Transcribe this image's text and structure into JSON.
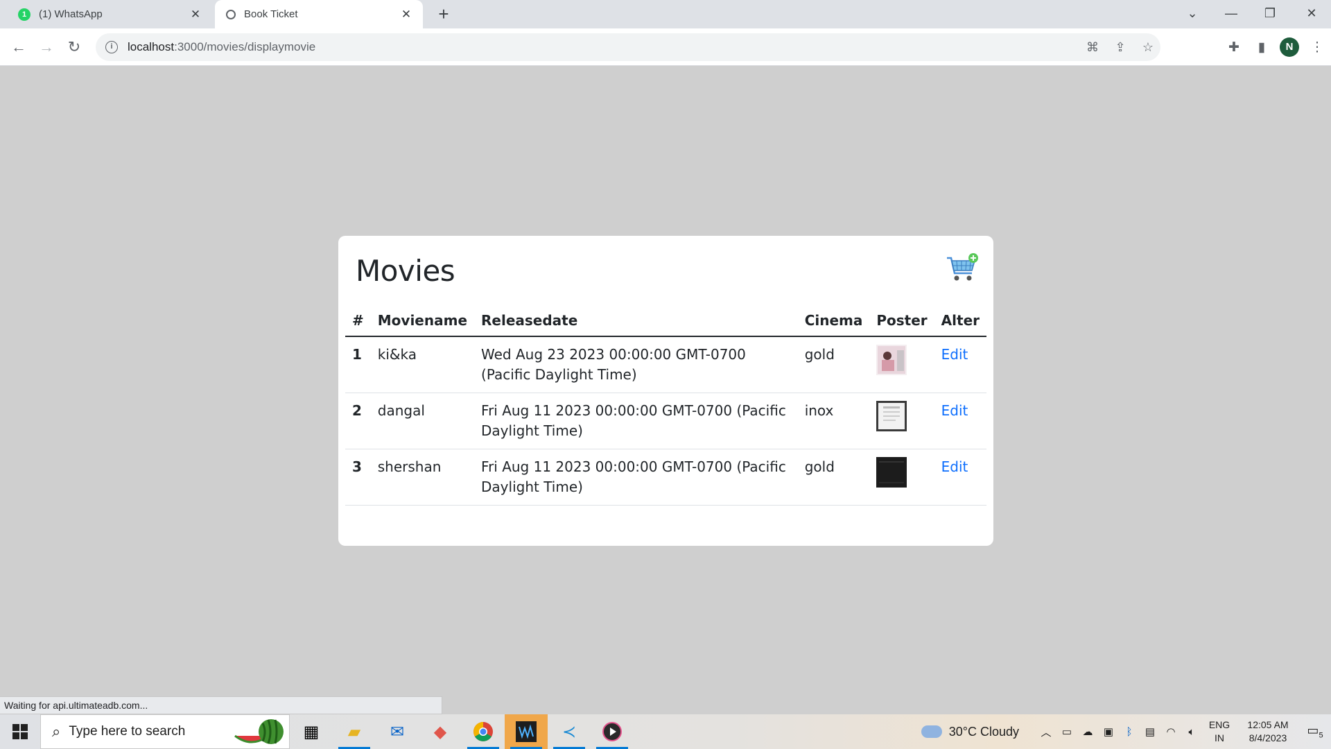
{
  "browser": {
    "tabs": [
      {
        "title": "(1) WhatsApp",
        "badge": "1",
        "active": false
      },
      {
        "title": "Book Ticket",
        "active": true
      }
    ],
    "url_host": "localhost",
    "url_path": ":3000/movies/displaymovie",
    "profile_initial": "N",
    "status_text": "Waiting for api.ultimateadb.com..."
  },
  "page": {
    "title": "Movies",
    "table": {
      "headers": [
        "#",
        "Moviename",
        "Releasedate",
        "Cinema",
        "Poster",
        "Alter"
      ],
      "rows": [
        {
          "num": "1",
          "name": "ki&ka",
          "date": "Wed Aug 23 2023 00:00:00 GMT-0700 (Pacific Daylight Time)",
          "cinema": "gold",
          "action": "Edit"
        },
        {
          "num": "2",
          "name": "dangal",
          "date": "Fri Aug 11 2023 00:00:00 GMT-0700 (Pacific Daylight Time)",
          "cinema": "inox",
          "action": "Edit"
        },
        {
          "num": "3",
          "name": "shershan",
          "date": "Fri Aug 11 2023 00:00:00 GMT-0700 (Pacific Daylight Time)",
          "cinema": "gold",
          "action": "Edit"
        }
      ]
    },
    "link_color": "#0d6efd"
  },
  "taskbar": {
    "search_placeholder": "Type here to search",
    "weather": "30°C  Cloudy",
    "lang_line1": "ENG",
    "lang_line2": "IN",
    "time": "12:05 AM",
    "date": "8/4/2023",
    "notification_count": "5"
  }
}
